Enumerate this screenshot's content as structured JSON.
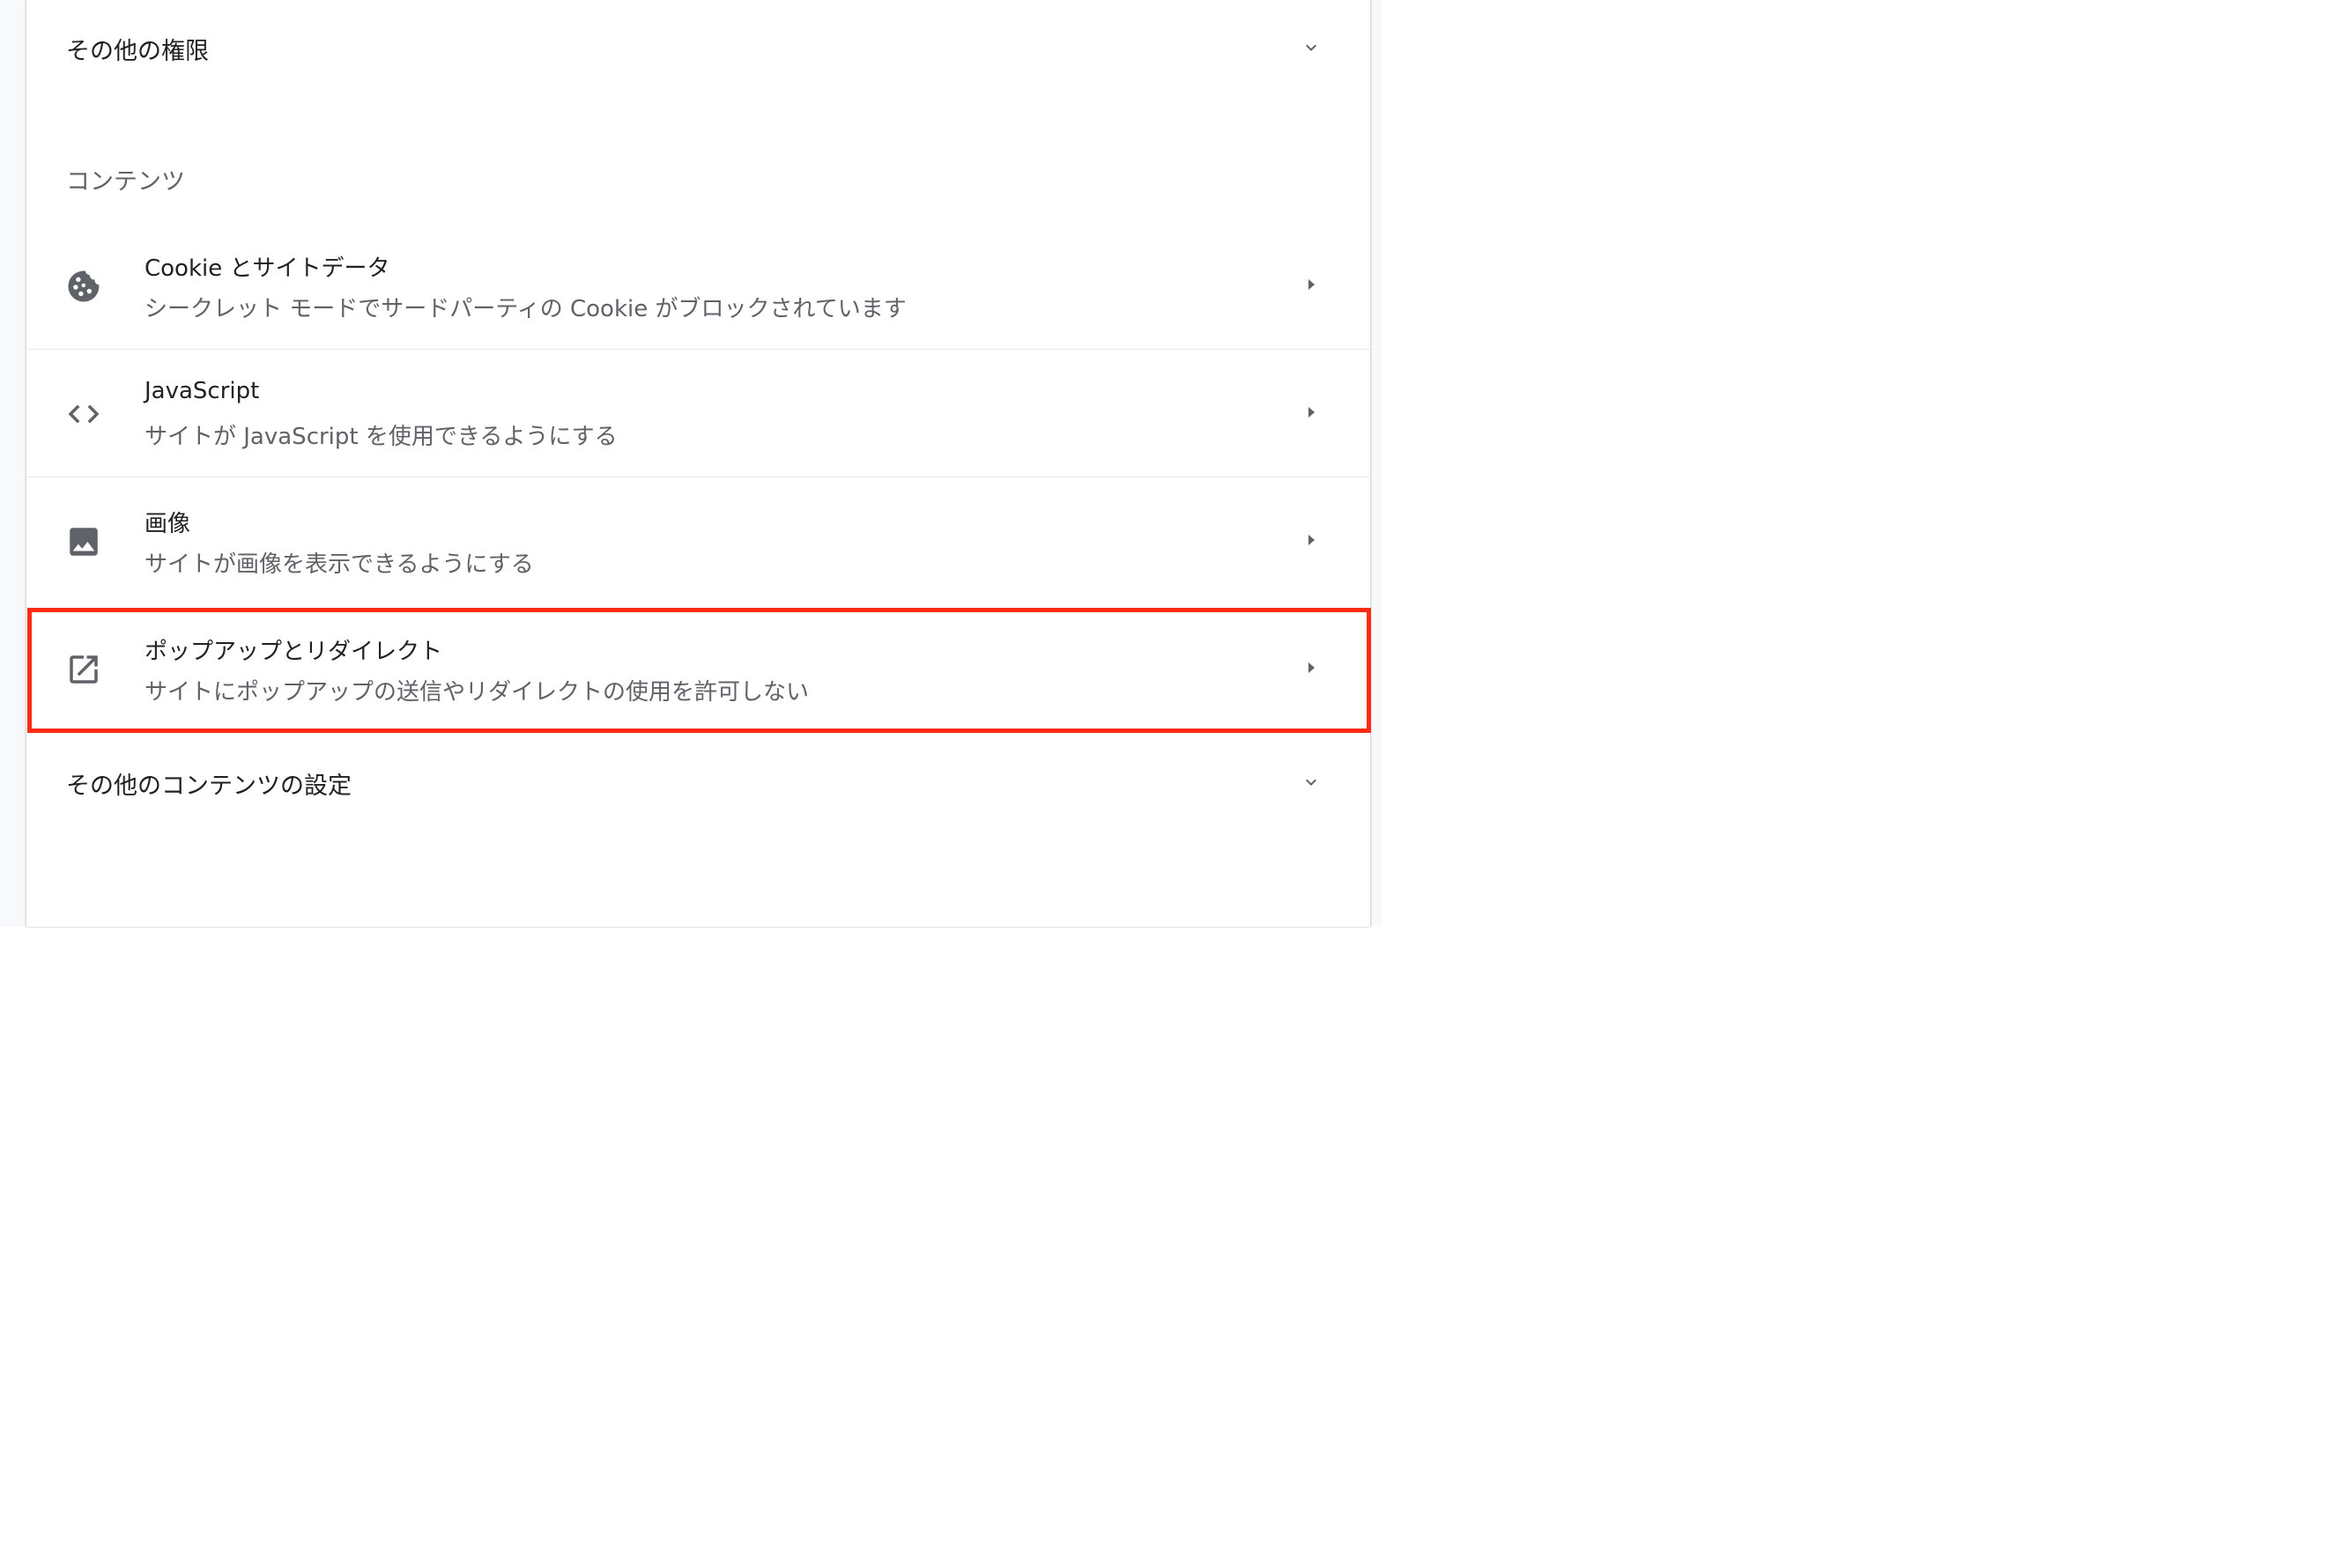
{
  "permissions": {
    "more_permissions_label": "その他の権限"
  },
  "content": {
    "section_title": "コンテンツ",
    "items": [
      {
        "title": "Cookie とサイトデータ",
        "subtitle": "シークレット モードでサードパーティの Cookie がブロックされています",
        "icon": "cookie-icon"
      },
      {
        "title": "JavaScript",
        "subtitle": "サイトが JavaScript を使用できるようにする",
        "icon": "code-icon"
      },
      {
        "title": "画像",
        "subtitle": "サイトが画像を表示できるようにする",
        "icon": "image-icon"
      },
      {
        "title": "ポップアップとリダイレクト",
        "subtitle": "サイトにポップアップの送信やリダイレクトの使用を許可しない",
        "icon": "open-in-new-icon"
      }
    ],
    "more_content_label": "その他のコンテンツの設定"
  },
  "colors": {
    "text_primary": "#202124",
    "text_secondary": "#5f6368",
    "icon": "#5f6368",
    "divider": "#e8eaed",
    "highlight": "#ff2b14"
  }
}
